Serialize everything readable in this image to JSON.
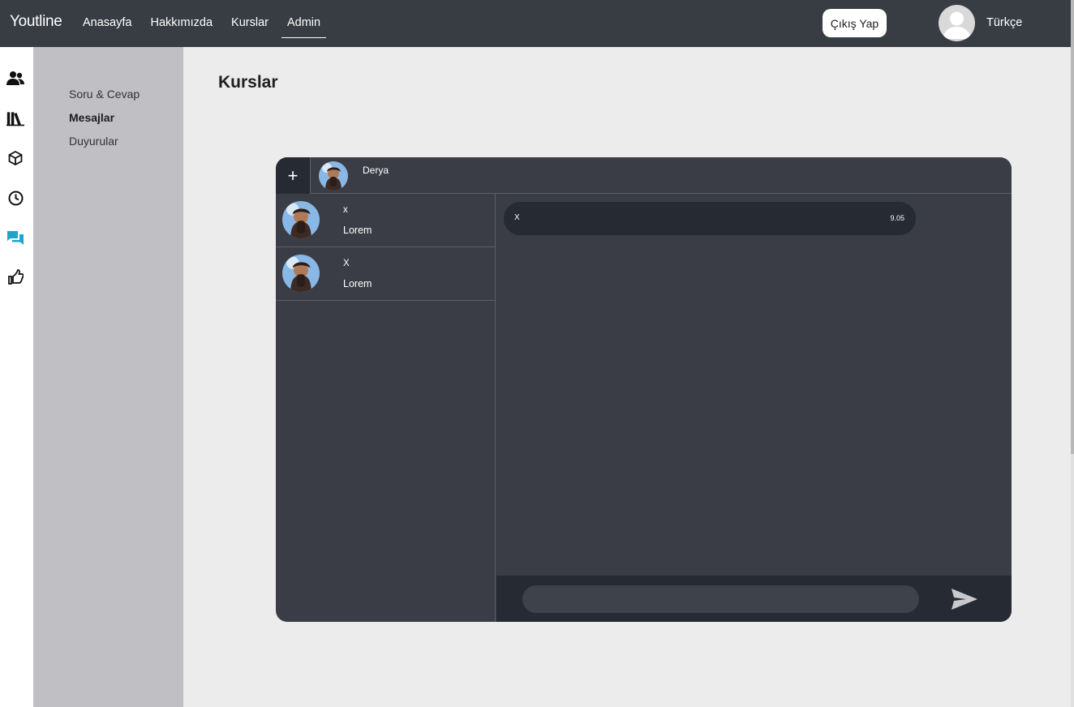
{
  "navbar": {
    "brand": "Youtline",
    "links": [
      "Anasayfa",
      "Hakkımızda",
      "Kurslar",
      "Admin"
    ],
    "active_link": "Admin",
    "logout_label": "Çıkış Yap",
    "language": "Türkçe"
  },
  "rail": {
    "icons": [
      "users-icon",
      "library-icon",
      "package-icon",
      "clock-icon",
      "chat-icon",
      "announce-icon"
    ],
    "active_icon": "chat-icon",
    "active_color": "#1fa5c9"
  },
  "submenu": {
    "items": [
      "Soru & Cevap",
      "Mesajlar",
      "Duyurular"
    ],
    "active": "Mesajlar"
  },
  "page": {
    "title": "Kurslar"
  },
  "chat": {
    "new_button": "+",
    "current_contact": "Derya",
    "contacts": [
      {
        "name": "x",
        "last_message": "Lorem"
      },
      {
        "name": "X",
        "last_message": "Lorem"
      }
    ],
    "messages": [
      {
        "text": "X",
        "time": "9.05"
      }
    ],
    "input_value": ""
  },
  "colors": {
    "navbar": "#383c43",
    "submenu": "#c0bfc3",
    "chat_panel": "#3a3d45",
    "chat_dark": "#262a33"
  }
}
